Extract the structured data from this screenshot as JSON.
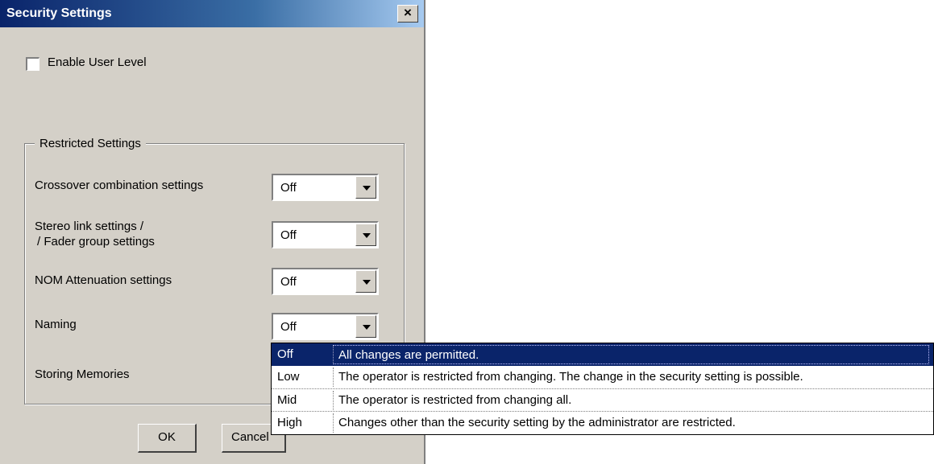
{
  "window": {
    "title": "Security Settings",
    "close_label": "×"
  },
  "enable_user_level": {
    "label": "Enable User Level",
    "checked": false
  },
  "restricted_settings": {
    "legend": "Restricted Settings",
    "rows": [
      {
        "label_line1": "Crossover combination settings",
        "label_line2": "",
        "value": "Off"
      },
      {
        "label_line1": "Stereo link settings /",
        "label_line2": "/ Fader group settings",
        "value": "Off"
      },
      {
        "label_line1": "NOM Attenuation settings",
        "label_line2": "",
        "value": "Off"
      },
      {
        "label_line1": "Naming",
        "label_line2": "",
        "value": "Off"
      },
      {
        "label_line1": "Storing Memories",
        "label_line2": "",
        "value": ""
      }
    ]
  },
  "buttons": {
    "ok": "OK",
    "cancel": "Cancel"
  },
  "dropdown": {
    "selected_index": 0,
    "options": [
      {
        "level": "Off",
        "description": "All changes are permitted."
      },
      {
        "level": "Low",
        "description": "The operator is restricted from changing. The change in the security setting is possible."
      },
      {
        "level": "Mid",
        "description": "The operator is restricted from changing all."
      },
      {
        "level": "High",
        "description": "Changes other than the security setting by the administrator are restricted."
      }
    ]
  },
  "colors": {
    "dialog_bg": "#d4d0c8",
    "titlebar_start": "#0a246a",
    "titlebar_end": "#a6caf0",
    "selection": "#0a246a"
  }
}
